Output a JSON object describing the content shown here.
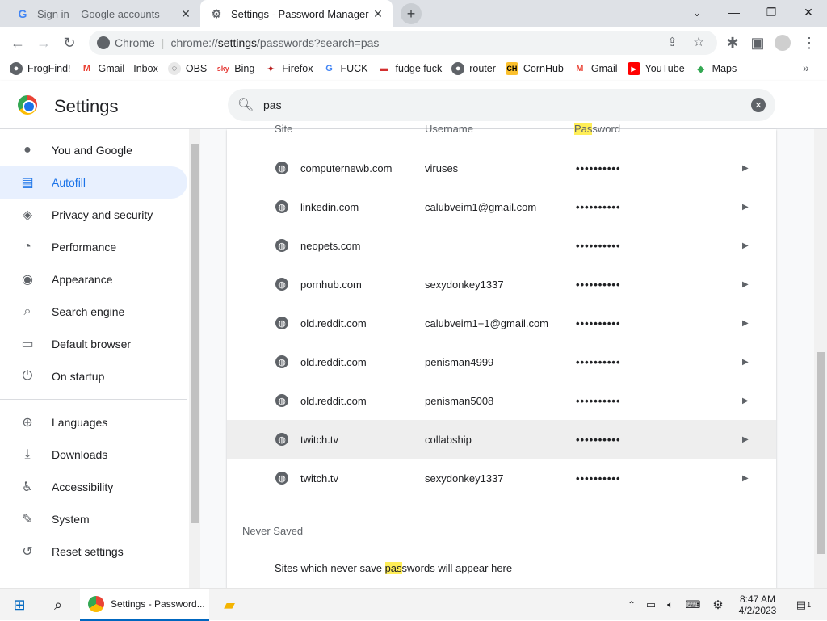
{
  "tabs": [
    {
      "title": "Sign in – Google accounts",
      "favicon": "google-g-icon"
    },
    {
      "title": "Settings - Password Manager",
      "favicon": "gear-icon"
    }
  ],
  "omnibox": {
    "chip": "Chrome",
    "url_prefix": "chrome://",
    "url_path": "settings",
    "url_rest": "/passwords?search=pas"
  },
  "bookmarks": [
    {
      "label": "FrogFind!",
      "icon": "globe-icon"
    },
    {
      "label": "Gmail - Inbox",
      "icon": "gmail-icon"
    },
    {
      "label": "OBS",
      "icon": "obs-icon"
    },
    {
      "label": "Bing",
      "icon": "bing-icon"
    },
    {
      "label": "Firefox",
      "icon": "firefox-icon"
    },
    {
      "label": "FUCK",
      "icon": "google-g-icon"
    },
    {
      "label": "fudge fuck",
      "icon": "bookmark-icon"
    },
    {
      "label": "router",
      "icon": "globe-icon"
    },
    {
      "label": "CornHub",
      "icon": "ch-icon"
    },
    {
      "label": "Gmail",
      "icon": "gmail-icon"
    },
    {
      "label": "YouTube",
      "icon": "youtube-icon"
    },
    {
      "label": "Maps",
      "icon": "maps-icon"
    }
  ],
  "header": {
    "title": "Settings",
    "search_value": "pas"
  },
  "sidebar": {
    "items": [
      {
        "label": "You and Google",
        "icon": "person-icon"
      },
      {
        "label": "Autofill",
        "icon": "clipboard-icon"
      },
      {
        "label": "Privacy and security",
        "icon": "shield-icon"
      },
      {
        "label": "Performance",
        "icon": "speedometer-icon"
      },
      {
        "label": "Appearance",
        "icon": "palette-icon"
      },
      {
        "label": "Search engine",
        "icon": "search-icon"
      },
      {
        "label": "Default browser",
        "icon": "browser-icon"
      },
      {
        "label": "On startup",
        "icon": "power-icon"
      },
      {
        "label": "Languages",
        "icon": "globe-icon"
      },
      {
        "label": "Downloads",
        "icon": "download-icon"
      },
      {
        "label": "Accessibility",
        "icon": "accessibility-icon"
      },
      {
        "label": "System",
        "icon": "wrench-icon"
      },
      {
        "label": "Reset settings",
        "icon": "restore-icon"
      }
    ]
  },
  "passwords": {
    "col_site": "Site",
    "col_username": "Username",
    "col_password_hl": "Pas",
    "col_password_rest": "sword",
    "rows": [
      {
        "site": "computernewb.com",
        "username": "viruses",
        "password": "••••••••••"
      },
      {
        "site": "linkedin.com",
        "username": "calubveim1@gmail.com",
        "password": "••••••••••"
      },
      {
        "site": "neopets.com",
        "username": "",
        "password": "••••••••••"
      },
      {
        "site": "pornhub.com",
        "username": "sexydonkey1337",
        "password": "••••••••••"
      },
      {
        "site": "old.reddit.com",
        "username": "calubveim1+1@gmail.com",
        "password": "••••••••••"
      },
      {
        "site": "old.reddit.com",
        "username": "penisman4999",
        "password": "••••••••••"
      },
      {
        "site": "old.reddit.com",
        "username": "penisman5008",
        "password": "••••••••••"
      },
      {
        "site": "twitch.tv",
        "username": "collabship",
        "password": "••••••••••"
      },
      {
        "site": "twitch.tv",
        "username": "sexydonkey1337",
        "password": "••••••••••"
      }
    ],
    "never_saved_heading": "Never Saved",
    "never_saved_pre": "Sites which never save ",
    "never_saved_hl": "pas",
    "never_saved_post": "swords will appear here"
  },
  "taskbar": {
    "chrome_label": "Settings - Password...",
    "time": "8:47 AM",
    "date": "4/2/2023",
    "notification_count": "1"
  },
  "colors": {
    "accent": "#1a73e8",
    "highlight": "#ffee58"
  }
}
